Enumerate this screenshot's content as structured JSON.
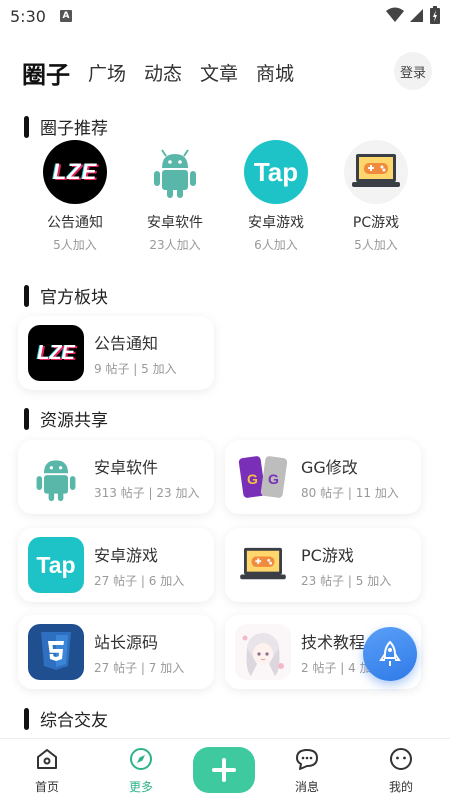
{
  "status_bar": {
    "time": "5:30",
    "notification_glyph": "A"
  },
  "top_nav": {
    "main": "圈子",
    "tabs": [
      "广场",
      "动态",
      "文章",
      "商城"
    ],
    "login": "登录"
  },
  "sections": {
    "recommend": "圈子推荐",
    "official": "官方板块",
    "resources": "资源共享",
    "social": "综合交友"
  },
  "recommend_items": [
    {
      "name": "公告通知",
      "count": "5人加入",
      "icon": "lze-logo"
    },
    {
      "name": "安卓软件",
      "count": "23人加入",
      "icon": "android-robot"
    },
    {
      "name": "安卓游戏",
      "count": "6人加入",
      "icon": "taptap-logo"
    },
    {
      "name": "PC游戏",
      "count": "5人加入",
      "icon": "gamepad-laptop"
    }
  ],
  "official_cards": [
    {
      "title": "公告通知",
      "sub": "9 帖子 | 5 加入",
      "icon": "lze-logo"
    }
  ],
  "resource_cards": [
    {
      "title": "安卓软件",
      "sub": "313 帖子 | 23 加入",
      "icon": "android-robot"
    },
    {
      "title": "GG修改",
      "sub": "80 帖子 | 11 加入",
      "icon": "gg-logo"
    },
    {
      "title": "安卓游戏",
      "sub": "27 帖子 | 6 加入",
      "icon": "taptap-logo"
    },
    {
      "title": "PC游戏",
      "sub": "23 帖子 | 5 加入",
      "icon": "gamepad-laptop"
    },
    {
      "title": "站长源码",
      "sub": "27 帖子 | 7 加入",
      "icon": "html5-logo"
    },
    {
      "title": "技术教程",
      "sub": "2 帖子 | 4 加入",
      "icon": "anime-girl-avatar"
    }
  ],
  "bottom_nav": [
    "首页",
    "更多",
    "消息",
    "我的"
  ],
  "brand": {
    "lze": "LZE",
    "tap": "Tap",
    "gg": "G"
  },
  "colors": {
    "accent_green": "#3ec99f",
    "tap_teal": "#1ec3c8",
    "rocket_blue": "#2f7ae8"
  }
}
